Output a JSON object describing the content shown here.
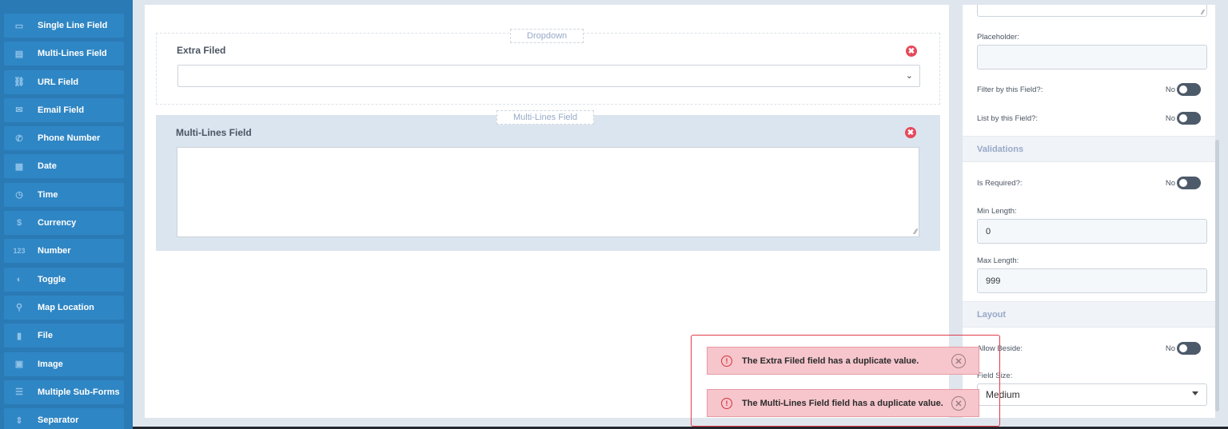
{
  "sidebar": {
    "items": [
      {
        "label": "Single Line Field",
        "icon": "single-line-icon",
        "glyph": "▭"
      },
      {
        "label": "Multi-Lines Field",
        "icon": "multi-lines-icon",
        "glyph": "▤"
      },
      {
        "label": "URL Field",
        "icon": "link-icon",
        "glyph": "⛓"
      },
      {
        "label": "Email Field",
        "icon": "email-icon",
        "glyph": "✉"
      },
      {
        "label": "Phone Number",
        "icon": "phone-icon",
        "glyph": "✆"
      },
      {
        "label": "Date",
        "icon": "calendar-icon",
        "glyph": "▦"
      },
      {
        "label": "Time",
        "icon": "clock-icon",
        "glyph": "◷"
      },
      {
        "label": "Currency",
        "icon": "dollar-icon",
        "glyph": "$"
      },
      {
        "label": "Number",
        "icon": "number-icon",
        "glyph": "123"
      },
      {
        "label": "Toggle",
        "icon": "toggle-icon",
        "glyph": "◐"
      },
      {
        "label": "Map Location",
        "icon": "map-icon",
        "glyph": "⚲"
      },
      {
        "label": "File",
        "icon": "file-icon",
        "glyph": "▮"
      },
      {
        "label": "Image",
        "icon": "image-icon",
        "glyph": "▣"
      },
      {
        "label": "Multiple Sub-Forms",
        "icon": "sub-forms-icon",
        "glyph": "☰"
      },
      {
        "label": "Separator",
        "icon": "separator-icon",
        "glyph": "⇕"
      }
    ]
  },
  "canvas": {
    "dropdown_block": {
      "tag": "Dropdown",
      "title": "Extra Filed",
      "remove": "✖"
    },
    "multi_block": {
      "tag": "Multi-Lines Field",
      "title": "Multi-Lines Field",
      "remove": "✖"
    }
  },
  "panel": {
    "placeholder_label": "Placeholder:",
    "placeholder_value": "",
    "filter_label": "Filter by this Field?:",
    "filter_value": "No",
    "list_label": "List by this Field?:",
    "list_value": "No",
    "validations_title": "Validations",
    "required_label": "Is Required?:",
    "required_value": "No",
    "min_label": "Min Length:",
    "min_value": "0",
    "max_label": "Max Length:",
    "max_value": "999",
    "layout_title": "Layout",
    "beside_label": "Allow Beside:",
    "beside_value": "No",
    "size_label": "Field Size:",
    "size_value": "Medium"
  },
  "toasts": [
    {
      "message": "The Extra Filed field has a duplicate value."
    },
    {
      "message": "The Multi-Lines Field field has a duplicate value."
    }
  ],
  "colors": {
    "sidebar": "#2a7ab5",
    "sidebar_item": "#2f86c4",
    "danger": "#e8485a",
    "toast_bg": "#f6c6cc"
  }
}
